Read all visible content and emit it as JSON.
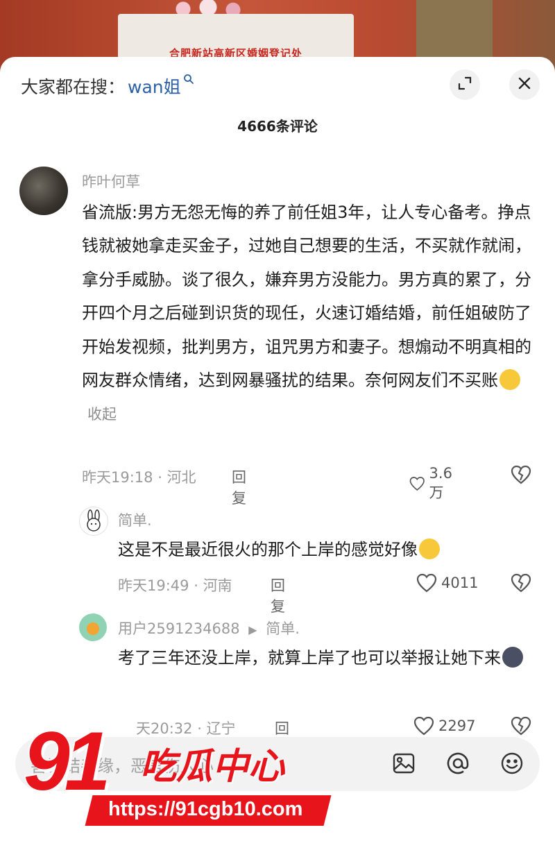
{
  "video": {
    "sign_text": "合肥新站高新区婚姻登记处"
  },
  "header": {
    "search_prefix": "大家都在搜：",
    "search_keyword": "wan姐",
    "comment_count": "4666条评论"
  },
  "comments": [
    {
      "username": "昨叶何草",
      "text": "省流版:男方无怨无悔的养了前任姐3年，让人专心备考。挣点钱就被她拿走买金子，过她自己想要的生活，不买就作就闹，拿分手威胁。谈了很久，嫌弃男方没能力。男方真的累了，分开四个月之后碰到识货的现任，火速订婚结婚，前任姐破防了开始发视频，批判男方，诅咒男方和妻子。想煽动不明真相的网友群众情绪，达到网暴骚扰的结果。奈何网友们不买账",
      "collapse": "收起",
      "time": "昨天19:18",
      "location": "河北",
      "reply": "回复",
      "likes": "3.6万"
    },
    {
      "username": "简单.",
      "text": "这是不是最近很火的那个上岸的感觉好像",
      "time": "昨天19:49",
      "location": "河南",
      "reply": "回复",
      "likes": "4011"
    },
    {
      "username": "用户2591234688",
      "reply_to": "简单.",
      "text": "考了三年还没上岸，就算上岸了也可以举报让她下来",
      "time": "天20:32",
      "location": "辽宁",
      "reply": "回复",
      "likes": "2297"
    }
  ],
  "input": {
    "placeholder": "善语结善缘，恶言伤人心"
  },
  "watermark": {
    "number": "91",
    "name": "吃瓜中心",
    "url": "https://91cgb10.com"
  },
  "colors": {
    "keyword": "#2b5fa8",
    "watermark_red": "#e8141c"
  },
  "icons": {
    "search": "search-icon",
    "expand": "expand-icon",
    "close": "close-icon",
    "like": "heart-icon",
    "dislike": "broken-heart-icon",
    "image": "image-icon",
    "mention": "at-icon",
    "emoji": "emoji-icon"
  }
}
